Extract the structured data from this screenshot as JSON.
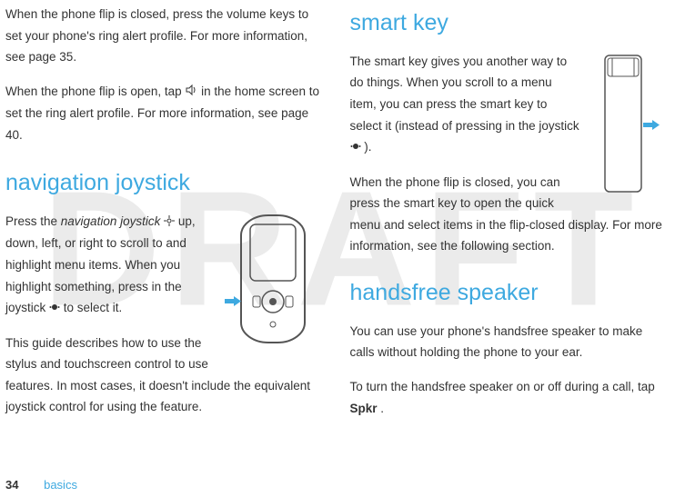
{
  "watermark": "DRAFT",
  "left": {
    "para1a": "When the phone flip is closed, press the volume keys to set your phone's ring alert profile. For more information, see page 35.",
    "para2a": "When the phone flip is open, tap ",
    "para2b": " in the home screen to set the ring alert profile. For more information, see page 40.",
    "heading1": "navigation joystick",
    "para3a": "Press the ",
    "para3_italic": "navigation joystick",
    "para3b": " up, down, left, or right to scroll to and highlight menu items. When you highlight something, press in the joystick ",
    "para3c": " to select it.",
    "para4": "This guide describes how to use the stylus and touchscreen control to use features. In most cases, it doesn't include the equivalent joystick control for using the feature."
  },
  "right": {
    "heading1": "smart key",
    "para1a": "The smart key gives you another way to do things. When you scroll to a menu item, you can press the smart key to select it (instead of pressing in the joystick ",
    "para1b": ").",
    "para2": "When the phone flip is closed, you can press the smart key to open the quick menu and select items in the flip-closed display. For more information, see the following section.",
    "heading2": "handsfree speaker",
    "para3": "You can use your phone's handsfree speaker to make calls without holding the phone to your ear.",
    "para4a": "To turn the handsfree speaker on or off during a call, tap ",
    "para4_bold": "Spkr",
    "para4b": "."
  },
  "footer": {
    "page": "34",
    "section": "basics"
  }
}
